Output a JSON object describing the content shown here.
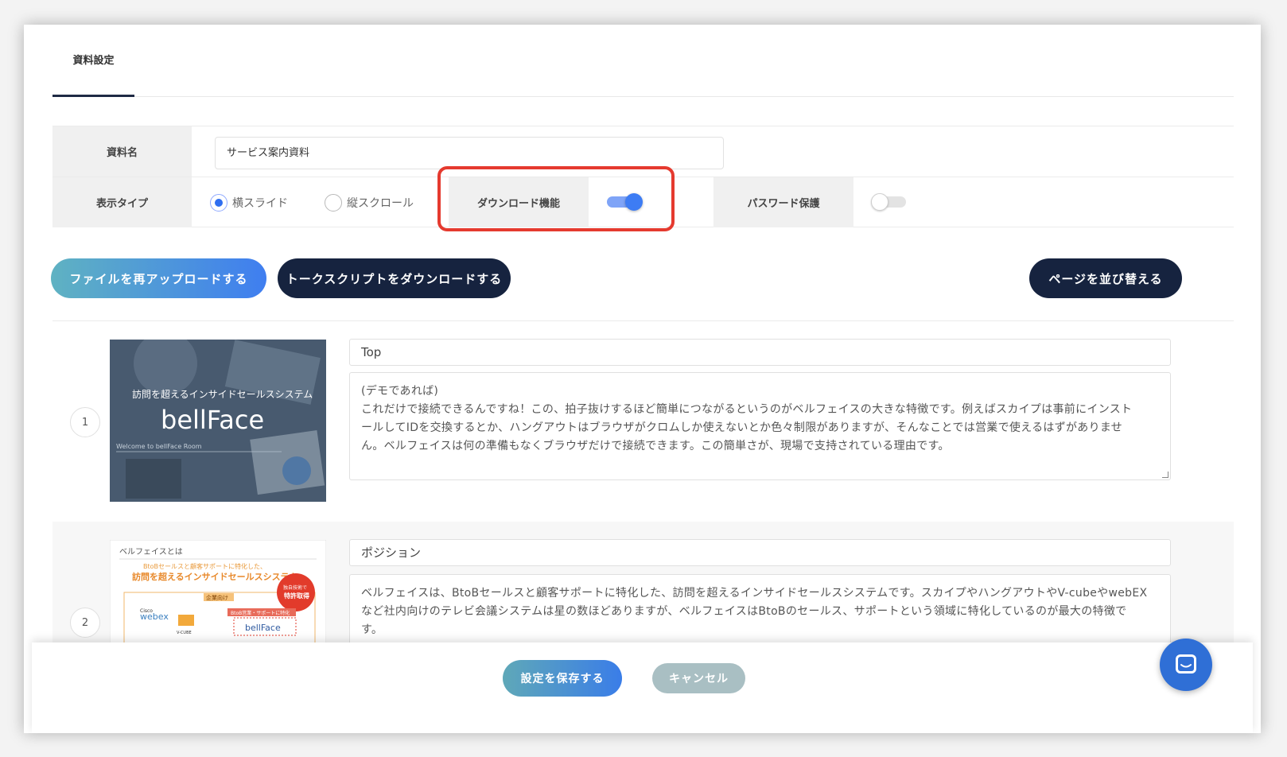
{
  "tabs": {
    "active": "資料設定"
  },
  "settings": {
    "name_label": "資料名",
    "name_value": "サービス案内資料",
    "display_type_label": "表示タイプ",
    "display_options": [
      "横スライド",
      "縦スクロール"
    ],
    "display_selected": "横スライド",
    "download_label": "ダウンロード機能",
    "download_enabled": true,
    "password_label": "パスワード保護",
    "password_enabled": false
  },
  "actions": {
    "reupload": "ファイルを再アップロードする",
    "download_script": "トークスクリプトをダウンロードする",
    "reorder_pages": "ページを並び替える"
  },
  "pages": [
    {
      "number": "1",
      "title": "Top",
      "note_lines": [
        "(デモであれば)",
        "これだけで接続できるんですね！この、拍子抜けするほど簡単につながるというのがベルフェイスの大きな特徴です。例えばスカイプは事前にインスト",
        "ールしてIDを交換するとか、ハングアウトはブラウザがクロムしか使えないとか色々制限がありますが、そんなことでは営業で使えるはずがありませ",
        "ん。ベルフェイスは何の準備もなくブラウザだけで接続できます。この簡単さが、現場で支持されている理由です。"
      ],
      "thumb": {
        "tagline": "訪問を超えるインサイドセールスシステム",
        "logo": "bellFace",
        "welcome": "Welcome to bellFace Room"
      }
    },
    {
      "number": "2",
      "title": "ポジション",
      "note_lines": [
        "ベルフェイスは、BtoBセールスと顧客サポートに特化した、訪問を超えるインサイドセールスシステムです。スカイプやハングアウトやV-cubeやwebEX",
        "など社内向けのテレビ会議システムは星の数ほどありますが、ベルフェイスはBtoBのセールス、サポートという領域に特化しているのが最大の特徴で",
        "す。"
      ],
      "thumb": {
        "heading": "ベルフェイスとは",
        "sub1": "BtoBセールスと顧客サポートに特化した、",
        "sub2": "訪問を超えるインサイドセールスシステム",
        "badge1": "独自技術で",
        "badge2": "特許取得",
        "left_tag": "企業向け",
        "right_tag": "BtoB営業・サポートに特化",
        "cisco": "Cisco",
        "webex": "webex",
        "vcube": "V-CUBE",
        "logo": "bellFace"
      }
    }
  ],
  "footer": {
    "save": "設定を保存する",
    "cancel": "キャンセル"
  },
  "colors": {
    "accent": "#3d7cf4",
    "dark": "#16233f",
    "highlight": "#e53a2f"
  }
}
